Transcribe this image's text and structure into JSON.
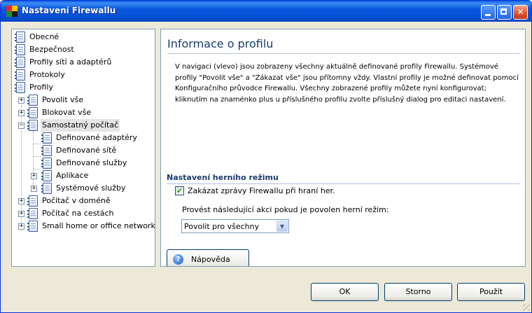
{
  "window": {
    "title": "Nastavení Firewallu",
    "buttons": {
      "minimize": "minimize-icon",
      "maximize": "maximize-icon",
      "close": "✕"
    }
  },
  "tree": {
    "items": [
      {
        "label": "Obecné"
      },
      {
        "label": "Bezpečnost"
      },
      {
        "label": "Profily sítí a adaptérů"
      },
      {
        "label": "Protokoly"
      },
      {
        "label": "Profily"
      },
      {
        "label": "Povolit vše",
        "expander": "+"
      },
      {
        "label": "Blokovat vše",
        "expander": "+"
      },
      {
        "label": "Samostatný počítač",
        "expander": "−",
        "selected": true
      },
      {
        "label": "Definované adaptéry"
      },
      {
        "label": "Definované sítě"
      },
      {
        "label": "Definované služby"
      },
      {
        "label": "Aplikace",
        "expander": "+"
      },
      {
        "label": "Systémové služby",
        "expander": "+"
      },
      {
        "label": "Počítač v doméně",
        "expander": "+"
      },
      {
        "label": "Počítač na cestách",
        "expander": "+"
      },
      {
        "label": "Small home or office network",
        "expander": "+"
      }
    ]
  },
  "content": {
    "heading": "Informace o profilu",
    "description": "V navigaci (vlevo) jsou zobrazeny všechny aktuálně definované profily Firewallu. Systémové profily \"Povolit vše\" a \"Zákazat vše\" jsou přítomny vždy. Vlastní profily je možné definovat pomocí Konfiguračního průvodce Firewallu. Všechny zobrazené profily můžete nyní konfigurovat; kliknutím na znaménko plus u příslušného profilu zvolte příslušný dialog pro editaci nastavení.",
    "game_mode": {
      "section_title": "Nastavení herního režimu",
      "checkbox_label": "Zakázat zprávy Firewallu při hraní her.",
      "checkbox_checked": true,
      "checkbox_mark": "✔",
      "combo_label": "Provést následující akci pokud je povolen herní režim:",
      "combo_value": "Povolit pro všechny",
      "combo_arrow": "▼"
    },
    "help_button": "Nápověda",
    "help_icon": "?"
  },
  "footer": {
    "ok": "OK",
    "cancel": "Storno",
    "apply": "Použít"
  },
  "colors": {
    "titlebar": "#0855dd",
    "heading": "#1a3b6e",
    "checkmark": "#21a121"
  }
}
